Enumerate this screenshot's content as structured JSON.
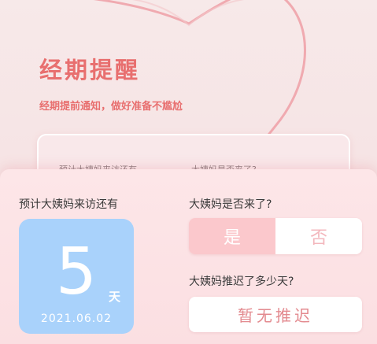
{
  "header": {
    "title": "经期提醒",
    "subtitle": "经期提前通知，做好准备不尴尬"
  },
  "back_card": {
    "countdown_label": "预计大姨妈来访还有",
    "arrived_question": "大姨妈是否来了?"
  },
  "countdown": {
    "label": "预计大姨妈来访还有",
    "days": "5",
    "unit": "天",
    "date": "2021.06.02"
  },
  "arrival": {
    "question": "大姨妈是否来了?",
    "yes_label": "是",
    "no_label": "否",
    "selected": "是"
  },
  "delay": {
    "question": "大姨妈推迟了多少天?",
    "value": "暂无推迟"
  },
  "colors": {
    "accent": "#e86f6f",
    "countdown_bg": "#a9d2fb",
    "yes_bg": "#fbc8cc",
    "no_text": "#f3b7bd",
    "delay_text": "#e38a8f"
  }
}
